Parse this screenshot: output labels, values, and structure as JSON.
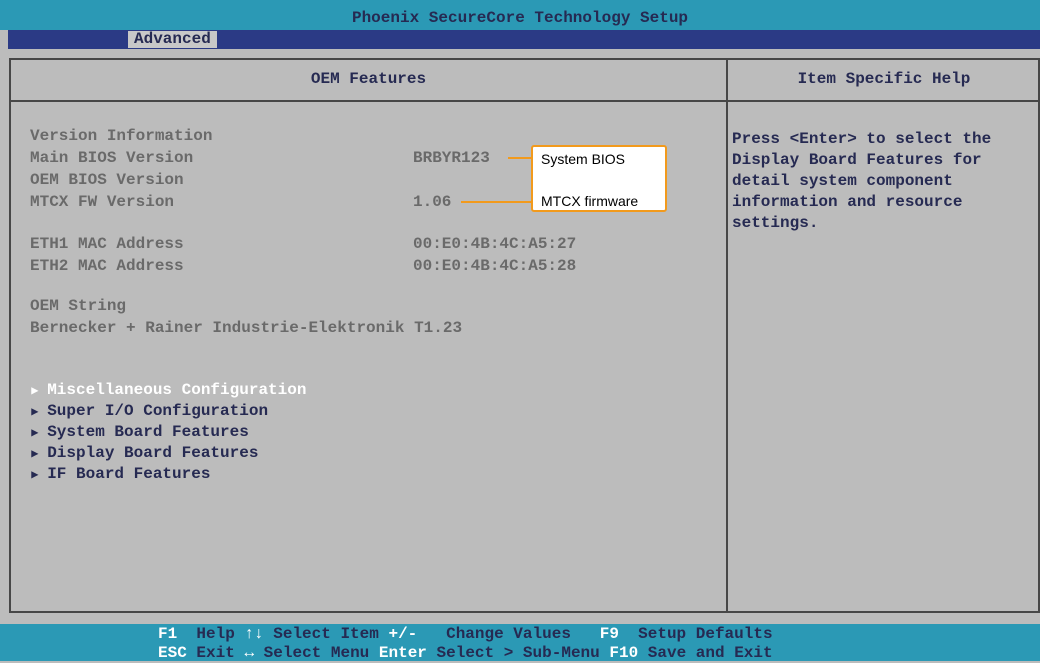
{
  "window": {
    "title": "Phoenix SecureCore Technology Setup",
    "active_tab": "Advanced"
  },
  "main": {
    "title": "OEM Features",
    "version_info_label": "Version Information",
    "rows": [
      {
        "label": "Main BIOS Version",
        "value": "BRBYR123"
      },
      {
        "label": "OEM BIOS Version",
        "value": ""
      },
      {
        "label": "MTCX FW Version",
        "value": "1.06"
      },
      {
        "label": "ETH1 MAC Address",
        "value": "00:E0:4B:4C:A5:27"
      },
      {
        "label": "ETH2 MAC Address",
        "value": "00:E0:4B:4C:A5:28"
      }
    ],
    "oem_string_label": "OEM String",
    "oem_string_value": "Bernecker + Rainer Industrie-Elektronik T1.23",
    "submenus": [
      {
        "label": "Miscellaneous Configuration",
        "selected": true
      },
      {
        "label": "Super I/O Configuration",
        "selected": false
      },
      {
        "label": "System Board Features",
        "selected": false
      },
      {
        "label": "Display Board Features",
        "selected": false
      },
      {
        "label": "IF Board Features",
        "selected": false
      }
    ],
    "submenu_arrow": "▶"
  },
  "help": {
    "title": "Item Specific Help",
    "text": "Press <Enter> to select the\nDisplay Board Features for\ndetail system component\ninformation and resource\nsettings."
  },
  "callouts": {
    "bios": "System BIOS",
    "mtcx": "MTCX firmware"
  },
  "footer": {
    "line1": [
      {
        "key": "F1",
        "desc": "Help"
      },
      {
        "key": "↑↓",
        "desc": "Select Item"
      },
      {
        "key": "+/-",
        "desc": "Change Values"
      },
      {
        "key": "F9",
        "desc": "Setup Defaults"
      }
    ],
    "line2": [
      {
        "key": "ESC",
        "desc": "Exit"
      },
      {
        "key": "↔",
        "desc": "Select Menu"
      },
      {
        "key": "Enter",
        "desc": "Select > Sub-Menu"
      },
      {
        "key": "F10",
        "desc": "Save and Exit"
      }
    ]
  },
  "colors": {
    "title_bar": "#2b99b5",
    "menu_bar": "#2b3a85",
    "panel": "#bcbcbc",
    "callout_border": "#f29a1c"
  }
}
